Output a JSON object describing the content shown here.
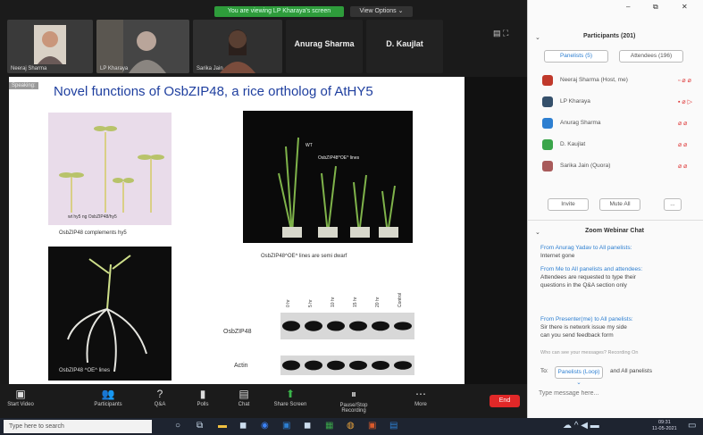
{
  "top": {
    "share_banner": "You are viewing LP Kharaya's screen",
    "view_options": "View Options ⌄"
  },
  "window_controls": {
    "minimize": "–",
    "maximize": "⧉",
    "close": "✕"
  },
  "videos": [
    {
      "name": "Neeraj Sharma"
    },
    {
      "name": "LP Kharaya"
    },
    {
      "name": "Sarika Jain"
    }
  ],
  "name_tiles": [
    {
      "name": "Anurag Sharma"
    },
    {
      "name": "D. Kaujlat"
    }
  ],
  "slide": {
    "presenter_tag": "Speaking:",
    "title": "Novel functions of OsbZIP48, a rice ortholog of AtHY5",
    "seedling_labels": "wt   hy5   ng   OsbZIP48/hy5",
    "cap_complements": "OsbZIP48 complements hy5",
    "cap_root": "OsbZIP48 ^OE^ lines",
    "plant_inner": "OsbZIP48^OE^ lines",
    "plant_wt": "WT",
    "cap_semi_dwarf": "OsbZIP48^OE^ lines are semi dwarf",
    "blot_columns": [
      "0 hr",
      "5 hr",
      "10 hr",
      "15 hr",
      "20 hr",
      "Control"
    ],
    "blot_row1": "OsbZIP48",
    "blot_row2": "Actin",
    "blot_bands_row1": [
      0.9,
      0.9,
      0.85,
      0.8,
      0.75,
      0.55
    ],
    "blot_bands_row2": [
      0.85,
      0.8,
      0.75,
      0.7,
      0.65,
      0.6
    ]
  },
  "panel": {
    "title": "Participants (201)",
    "tabs": [
      "Panelists (5)",
      "Attendees (196)"
    ],
    "participants": [
      {
        "name": "Neeraj Sharma (Host, me)",
        "color": "#c0392b",
        "status": "▫ ⌀ ⌀"
      },
      {
        "name": "LP Kharaya",
        "color": "#35506b",
        "status": "▪ ⌀ ▷"
      },
      {
        "name": "Anurag Sharma",
        "color": "#2d7fd1",
        "status": "⌀ ⌀"
      },
      {
        "name": "D. Kaujlat",
        "color": "#3aa54a",
        "status": "⌀ ⌀"
      },
      {
        "name": "Sarika Jain (Quora)",
        "color": "#a85a5a",
        "status": "⌀ ⌀"
      }
    ],
    "invite_btn": "Invite",
    "mute_btn": "Mute All",
    "more_btn": "...",
    "chat_title": "Zoom Webinar Chat",
    "chat": [
      {
        "from": "From Anurag Yadav to All panelists:",
        "msg": "Internet gone"
      },
      {
        "from": "From Me to All panelists and attendees:",
        "msg": "Attendees are requested to type their"
      },
      {
        "from": "",
        "msg": "questions in the Q&A section only"
      },
      {
        "from": "From Presenter(me) to All panelists:",
        "msg": "Sir there is network issue my side"
      },
      {
        "from": "",
        "msg": "can you send feedback form"
      }
    ],
    "chat_note": "Who can see your messages? Recording On",
    "to_label": "To:",
    "to_value": "Panelists (Loop) ⌄",
    "and_label": "and All panelists",
    "input_placeholder": "Type message here..."
  },
  "toolbar": [
    {
      "label": "Start Video",
      "icon": "▣"
    },
    {
      "label": "Participants",
      "icon": "👥"
    },
    {
      "label": "Q&A",
      "icon": "?"
    },
    {
      "label": "Polls",
      "icon": "▮"
    },
    {
      "label": "Chat",
      "icon": "▤"
    },
    {
      "label": "Share Screen",
      "icon": "⬆"
    },
    {
      "label": "Pause/Stop Recording",
      "icon": "⏸"
    },
    {
      "label": "More",
      "icon": "⋯"
    }
  ],
  "end_label": "End",
  "taskbar": {
    "search": "Type here to search",
    "time": "09:31",
    "date": "11-05-2021"
  }
}
